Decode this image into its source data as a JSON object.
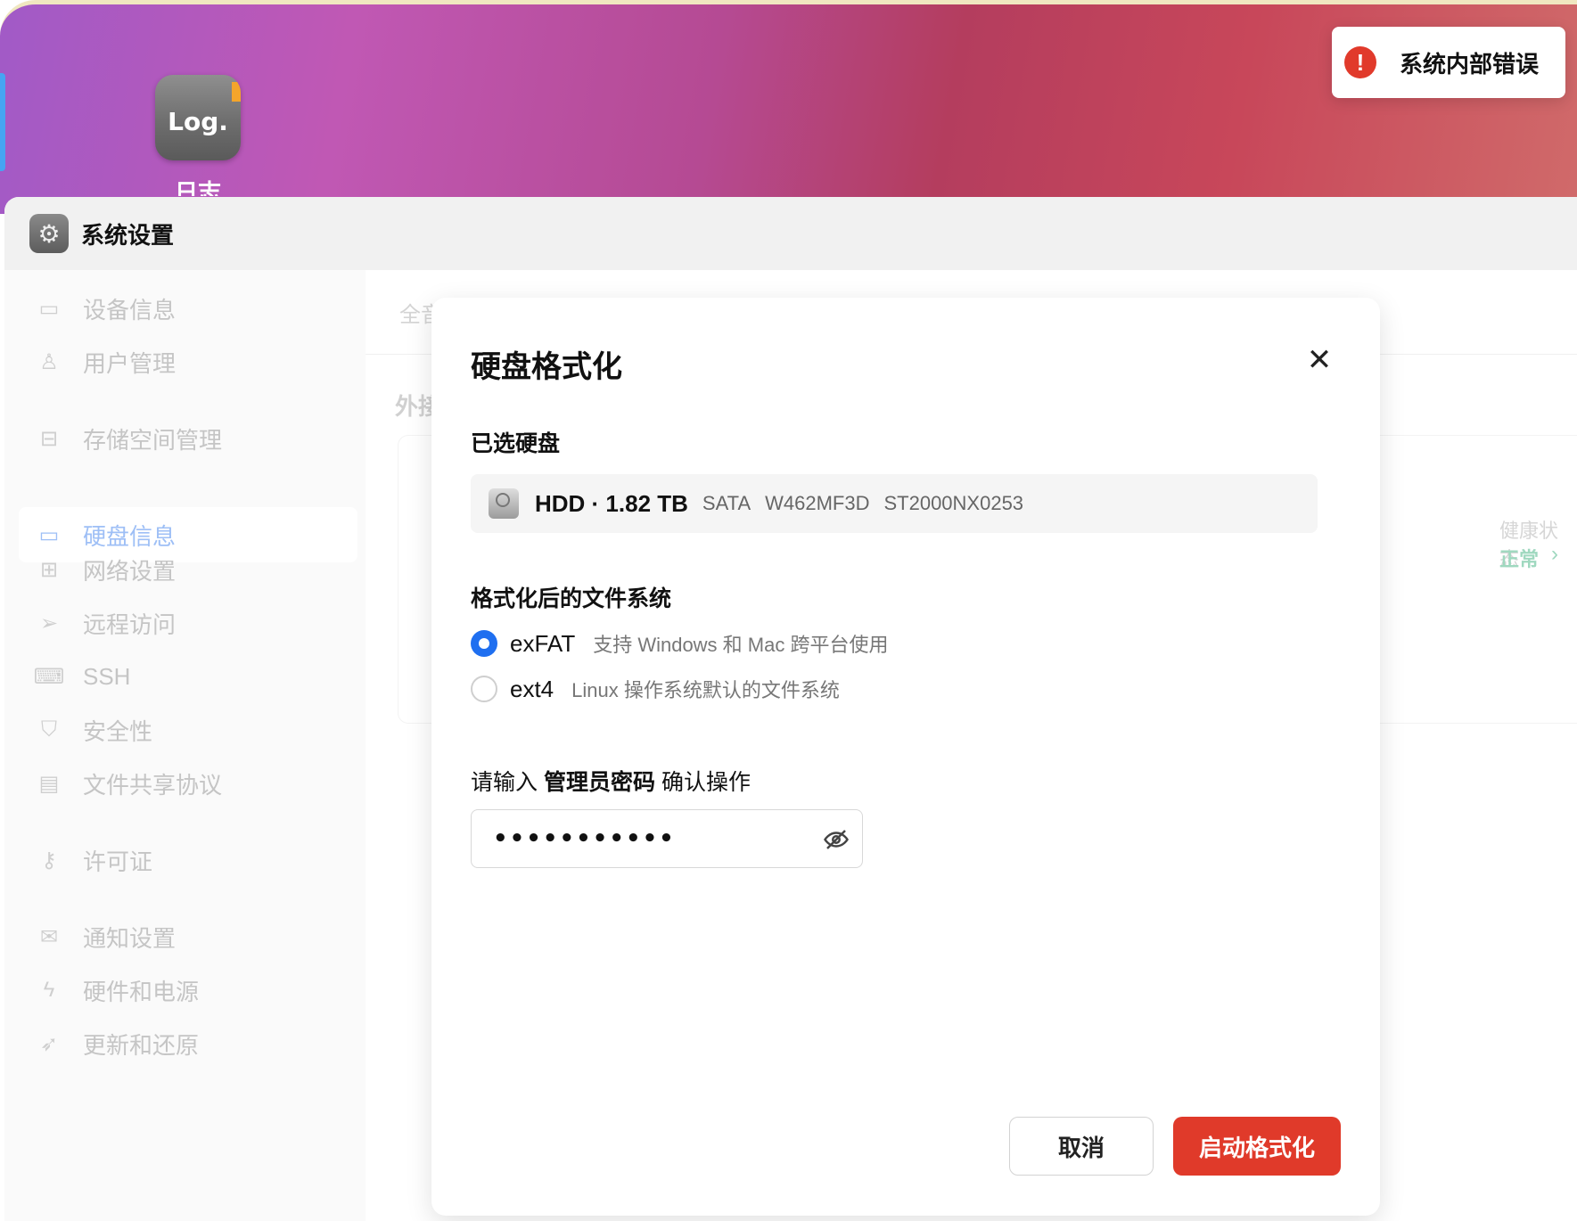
{
  "desktop": {
    "icon_text": "Log.",
    "icon_label": "日志"
  },
  "toast": {
    "message": "系统内部错误",
    "icon": "error-circle-icon",
    "color": "#e13a2b"
  },
  "window": {
    "title": "系统设置"
  },
  "sidebar": {
    "items": [
      {
        "label": "设备信息",
        "icon": "drive-icon"
      },
      {
        "label": "用户管理",
        "icon": "user-icon"
      },
      {
        "label": "存储空间管理",
        "icon": "inbox-icon"
      },
      {
        "label": "硬盘信息",
        "icon": "drive-icon",
        "active": true
      },
      {
        "label": "网络设置",
        "icon": "network-icon"
      },
      {
        "label": "远程访问",
        "icon": "send-icon"
      },
      {
        "label": "SSH",
        "icon": "code-icon"
      },
      {
        "label": "安全性",
        "icon": "shield-icon"
      },
      {
        "label": "文件共享协议",
        "icon": "file-icon"
      },
      {
        "label": "许可证",
        "icon": "key-icon"
      },
      {
        "label": "通知设置",
        "icon": "mail-icon"
      },
      {
        "label": "硬件和电源",
        "icon": "power-icon"
      },
      {
        "label": "更新和还原",
        "icon": "rocket-icon"
      }
    ]
  },
  "content": {
    "tab_fragment": "全音",
    "section_fragment": "外接",
    "health_label": "健康状态",
    "health_value": "正常"
  },
  "modal": {
    "title": "硬盘格式化",
    "selected_disk_label": "已选硬盘",
    "disk": {
      "name": "HDD · 1.82 TB",
      "interface": "SATA",
      "serial": "W462MF3D",
      "model": "ST2000NX0253"
    },
    "fs_label": "格式化后的文件系统",
    "fs_options": [
      {
        "name": "exFAT",
        "desc": "支持 Windows 和 Mac 跨平台使用",
        "selected": true
      },
      {
        "name": "ext4",
        "desc": "Linux 操作系统默认的文件系统",
        "selected": false
      }
    ],
    "password_prompt": {
      "before": "请输入",
      "emphasis": "管理员密码",
      "after": "确认操作"
    },
    "password_value": "•••••••••••",
    "cancel_label": "取消",
    "confirm_label": "启动格式化",
    "accent_color": "#1f6ff0",
    "danger_color": "#e03a2a"
  }
}
